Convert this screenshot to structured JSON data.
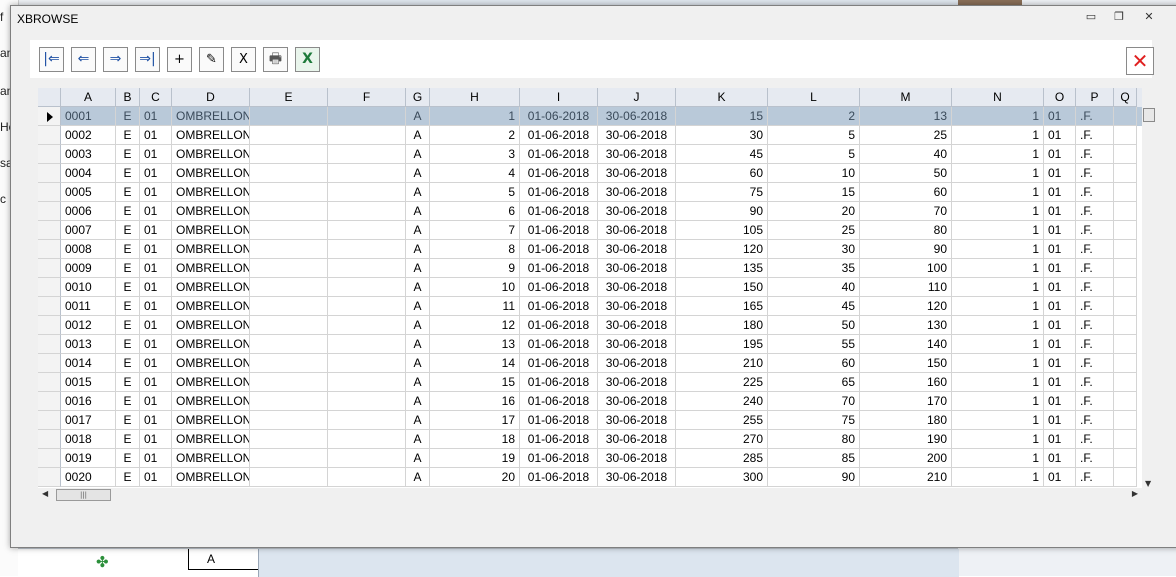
{
  "window": {
    "title": "XBROWSE",
    "minimize_glyph": "▭",
    "maximize_glyph": "❐",
    "close_glyph": "✕"
  },
  "toolbar": {
    "first_glyph": "|⇐",
    "prev_glyph": "⇐",
    "next_glyph": "⇒",
    "last_glyph": "⇒|",
    "add_label": "+",
    "edit_glyph": "✎",
    "delete_label": "X",
    "print_glyph": "🖶",
    "excel_glyph": "X",
    "close_label": "✕"
  },
  "colors": {
    "header_bg": "#e6eaf1",
    "selected_row_bg": "#b9c9d9",
    "close_red": "#e02020",
    "excel_green": "#1d7a3a"
  },
  "background": {
    "left_fragments": [
      "f",
      "an",
      "an",
      "Ho",
      "sa",
      "c"
    ],
    "bottom_cell": "A"
  },
  "columns": [
    "A",
    "B",
    "C",
    "D",
    "E",
    "F",
    "G",
    "H",
    "I",
    "J",
    "K",
    "L",
    "M",
    "N",
    "O",
    "P",
    "Q"
  ],
  "rows": [
    [
      "0001",
      "E",
      "01",
      "OMBRELLONI",
      "",
      "",
      "A",
      "1",
      "01-06-2018",
      "30-06-2018",
      "15",
      "2",
      "13",
      "1",
      "01",
      ".F."
    ],
    [
      "0002",
      "E",
      "01",
      "OMBRELLONI",
      "",
      "",
      "A",
      "2",
      "01-06-2018",
      "30-06-2018",
      "30",
      "5",
      "25",
      "1",
      "01",
      ".F."
    ],
    [
      "0003",
      "E",
      "01",
      "OMBRELLONI",
      "",
      "",
      "A",
      "3",
      "01-06-2018",
      "30-06-2018",
      "45",
      "5",
      "40",
      "1",
      "01",
      ".F."
    ],
    [
      "0004",
      "E",
      "01",
      "OMBRELLONI",
      "",
      "",
      "A",
      "4",
      "01-06-2018",
      "30-06-2018",
      "60",
      "10",
      "50",
      "1",
      "01",
      ".F."
    ],
    [
      "0005",
      "E",
      "01",
      "OMBRELLONI",
      "",
      "",
      "A",
      "5",
      "01-06-2018",
      "30-06-2018",
      "75",
      "15",
      "60",
      "1",
      "01",
      ".F."
    ],
    [
      "0006",
      "E",
      "01",
      "OMBRELLONI",
      "",
      "",
      "A",
      "6",
      "01-06-2018",
      "30-06-2018",
      "90",
      "20",
      "70",
      "1",
      "01",
      ".F."
    ],
    [
      "0007",
      "E",
      "01",
      "OMBRELLONI",
      "",
      "",
      "A",
      "7",
      "01-06-2018",
      "30-06-2018",
      "105",
      "25",
      "80",
      "1",
      "01",
      ".F."
    ],
    [
      "0008",
      "E",
      "01",
      "OMBRELLONI",
      "",
      "",
      "A",
      "8",
      "01-06-2018",
      "30-06-2018",
      "120",
      "30",
      "90",
      "1",
      "01",
      ".F."
    ],
    [
      "0009",
      "E",
      "01",
      "OMBRELLONI",
      "",
      "",
      "A",
      "9",
      "01-06-2018",
      "30-06-2018",
      "135",
      "35",
      "100",
      "1",
      "01",
      ".F."
    ],
    [
      "0010",
      "E",
      "01",
      "OMBRELLONI",
      "",
      "",
      "A",
      "10",
      "01-06-2018",
      "30-06-2018",
      "150",
      "40",
      "110",
      "1",
      "01",
      ".F."
    ],
    [
      "0011",
      "E",
      "01",
      "OMBRELLONI",
      "",
      "",
      "A",
      "11",
      "01-06-2018",
      "30-06-2018",
      "165",
      "45",
      "120",
      "1",
      "01",
      ".F."
    ],
    [
      "0012",
      "E",
      "01",
      "OMBRELLONI",
      "",
      "",
      "A",
      "12",
      "01-06-2018",
      "30-06-2018",
      "180",
      "50",
      "130",
      "1",
      "01",
      ".F."
    ],
    [
      "0013",
      "E",
      "01",
      "OMBRELLONI",
      "",
      "",
      "A",
      "13",
      "01-06-2018",
      "30-06-2018",
      "195",
      "55",
      "140",
      "1",
      "01",
      ".F."
    ],
    [
      "0014",
      "E",
      "01",
      "OMBRELLONI",
      "",
      "",
      "A",
      "14",
      "01-06-2018",
      "30-06-2018",
      "210",
      "60",
      "150",
      "1",
      "01",
      ".F."
    ],
    [
      "0015",
      "E",
      "01",
      "OMBRELLONI",
      "",
      "",
      "A",
      "15",
      "01-06-2018",
      "30-06-2018",
      "225",
      "65",
      "160",
      "1",
      "01",
      ".F."
    ],
    [
      "0016",
      "E",
      "01",
      "OMBRELLONI",
      "",
      "",
      "A",
      "16",
      "01-06-2018",
      "30-06-2018",
      "240",
      "70",
      "170",
      "1",
      "01",
      ".F."
    ],
    [
      "0017",
      "E",
      "01",
      "OMBRELLONI",
      "",
      "",
      "A",
      "17",
      "01-06-2018",
      "30-06-2018",
      "255",
      "75",
      "180",
      "1",
      "01",
      ".F."
    ],
    [
      "0018",
      "E",
      "01",
      "OMBRELLONI",
      "",
      "",
      "A",
      "18",
      "01-06-2018",
      "30-06-2018",
      "270",
      "80",
      "190",
      "1",
      "01",
      ".F."
    ],
    [
      "0019",
      "E",
      "01",
      "OMBRELLONI",
      "",
      "",
      "A",
      "19",
      "01-06-2018",
      "30-06-2018",
      "285",
      "85",
      "200",
      "1",
      "01",
      ".F."
    ],
    [
      "0020",
      "E",
      "01",
      "OMBRELLONI",
      "",
      "",
      "A",
      "20",
      "01-06-2018",
      "30-06-2018",
      "300",
      "90",
      "210",
      "1",
      "01",
      ".F."
    ]
  ],
  "selected_row": 0,
  "hscroll_thumb_glyph": "|||"
}
